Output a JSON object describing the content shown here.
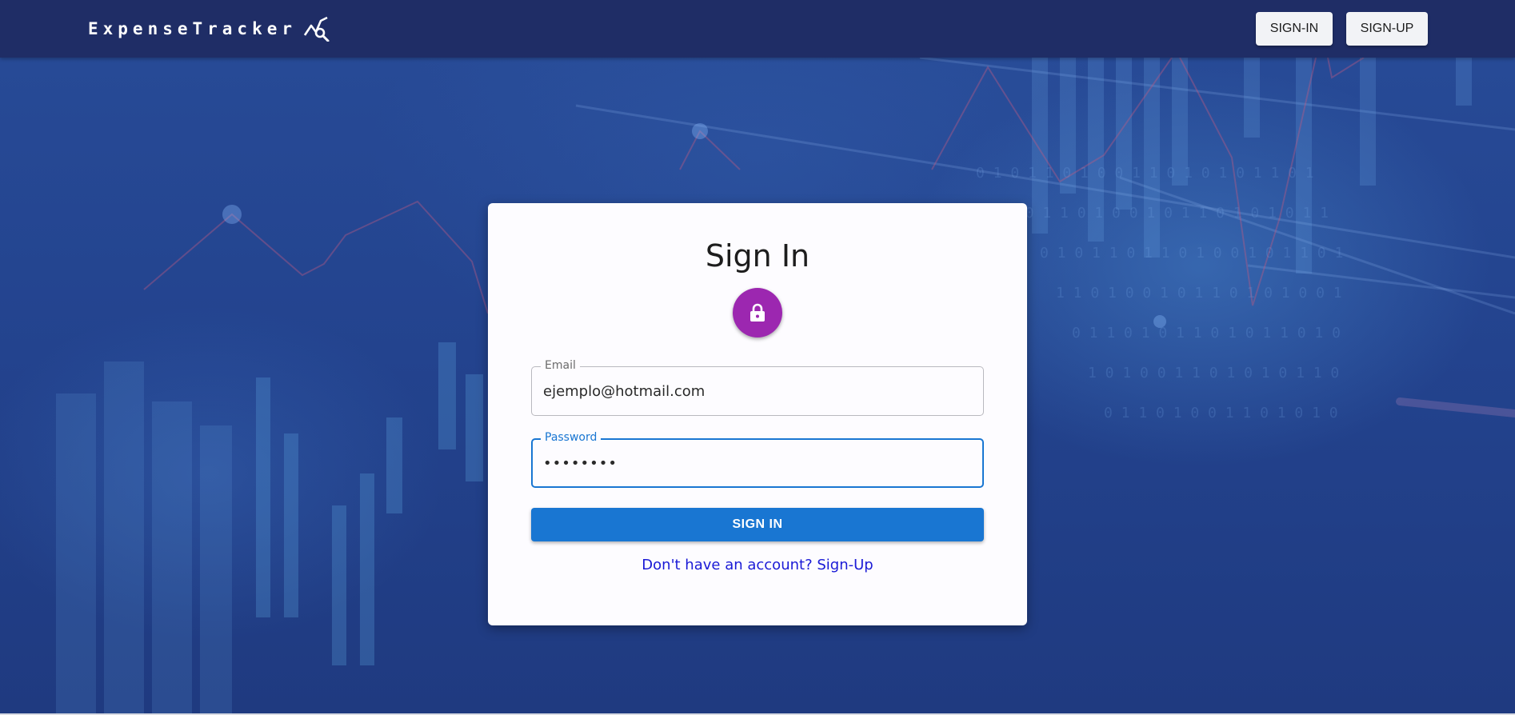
{
  "header": {
    "brand": "ExpenseTracker",
    "brand_icon": "chart-search-icon",
    "nav": {
      "signin_label": "SIGN-IN",
      "signup_label": "SIGN-UP"
    }
  },
  "card": {
    "title": "Sign In",
    "avatar_icon": "lock-icon",
    "avatar_color": "#9c27b0",
    "email": {
      "label": "Email",
      "value": "ejemplo@hotmail.com"
    },
    "password": {
      "label": "Password",
      "value": "••••••••",
      "focused": true
    },
    "submit_label": "SIGN IN",
    "signup_link": "Don't have an account? Sign-Up"
  },
  "colors": {
    "appbar": "#1f2d66",
    "primary": "#1976d2",
    "link": "#1a1ad6"
  }
}
